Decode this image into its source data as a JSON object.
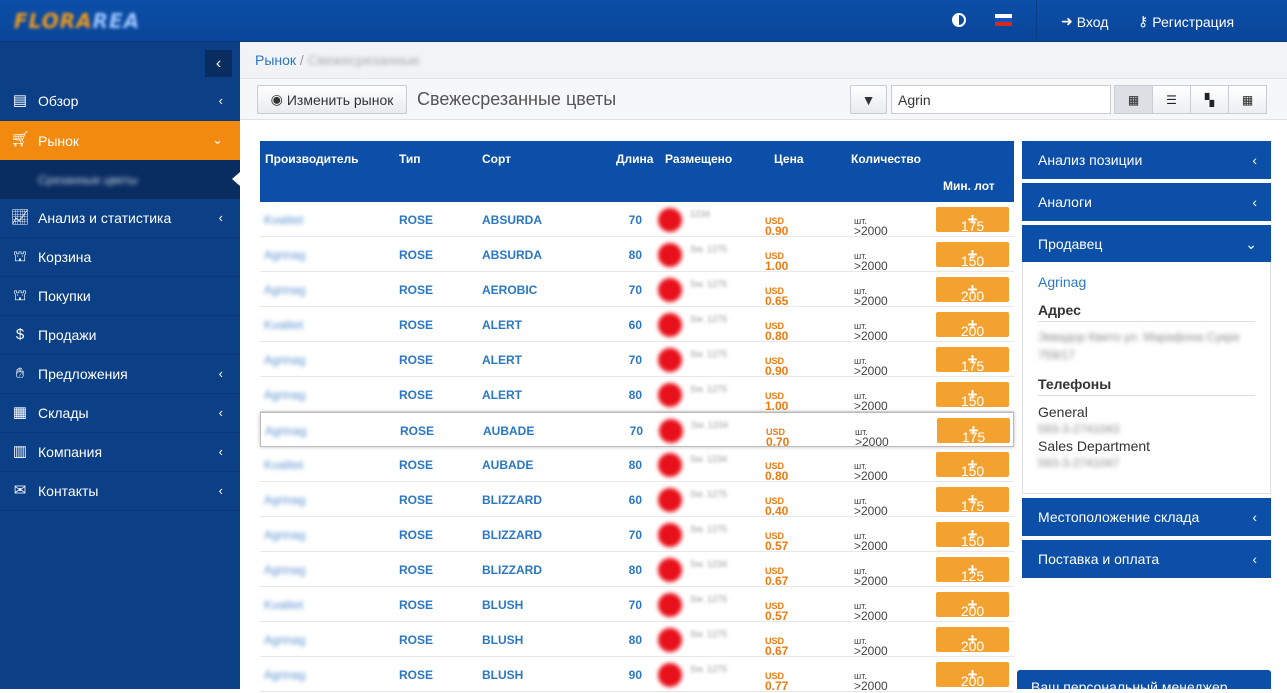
{
  "logo": {
    "text_a": "FLORA",
    "text_b": "REA"
  },
  "header": {
    "login": "Вход",
    "register": "Регистрация",
    "colors": {
      "bar": "#0b4fa8",
      "accent": "#f28a10"
    }
  },
  "sidebar": {
    "items": [
      {
        "label": "Обзор",
        "icon": "dashboard-icon",
        "chev": "‹"
      },
      {
        "label": "Рынок",
        "icon": "cart-icon",
        "chev": "⌄"
      },
      {
        "label": "Анализ и статистика",
        "icon": "chart-icon",
        "chev": "‹"
      },
      {
        "label": "Корзина",
        "icon": "basket-icon",
        "chev": ""
      },
      {
        "label": "Покупки",
        "icon": "purchases-icon",
        "chev": ""
      },
      {
        "label": "Продажи",
        "icon": "sales-icon",
        "chev": ""
      },
      {
        "label": "Предложения",
        "icon": "offers-icon",
        "chev": "‹"
      },
      {
        "label": "Склады",
        "icon": "warehouse-icon",
        "chev": "‹"
      },
      {
        "label": "Компания",
        "icon": "building-icon",
        "chev": "‹"
      },
      {
        "label": "Контакты",
        "icon": "envelope-icon",
        "chev": "‹"
      }
    ],
    "sub": "Срезанные цветы"
  },
  "breadcrumb": {
    "root": "Рынок",
    "current": "Свежесрезанные"
  },
  "toolbar": {
    "change_market": "Изменить рынок",
    "title": "Свежесрезанные цветы",
    "search_value": "Agrin"
  },
  "table": {
    "headers": {
      "producer": "Производитель",
      "type": "Тип",
      "sort": "Сорт",
      "length": "Длина",
      "placed": "Размещено",
      "price": "Цена",
      "qty": "Количество",
      "min_lot": "Мин. лот"
    },
    "rows": [
      {
        "prod": "Kvalitet",
        "type": "ROSE",
        "sort": "ABSURDA",
        "len": "70",
        "place": "1234",
        "price": "0.90",
        "qty": ">2000",
        "lot": "175"
      },
      {
        "prod": "Agrinag",
        "type": "ROSE",
        "sort": "ABSURDA",
        "len": "80",
        "place": "Sw. 1275",
        "price": "1.00",
        "qty": ">2000",
        "lot": "150"
      },
      {
        "prod": "Agrinag",
        "type": "ROSE",
        "sort": "AEROBIC",
        "len": "70",
        "place": "Sw. 1275",
        "price": "0.65",
        "qty": ">2000",
        "lot": "200"
      },
      {
        "prod": "Kvalitet",
        "type": "ROSE",
        "sort": "ALERT",
        "len": "60",
        "place": "Sw. 1275",
        "price": "0.80",
        "qty": ">2000",
        "lot": "200"
      },
      {
        "prod": "Agrinag",
        "type": "ROSE",
        "sort": "ALERT",
        "len": "70",
        "place": "Sw. 1275",
        "price": "0.90",
        "qty": ">2000",
        "lot": "175"
      },
      {
        "prod": "Agrinag",
        "type": "ROSE",
        "sort": "ALERT",
        "len": "80",
        "place": "Sw. 1275",
        "price": "1.00",
        "qty": ">2000",
        "lot": "150"
      },
      {
        "prod": "Agrinag",
        "type": "ROSE",
        "sort": "AUBADE",
        "len": "70",
        "place": "Sw. 1234",
        "price": "0.70",
        "qty": ">2000",
        "lot": "175"
      },
      {
        "prod": "Kvalitet",
        "type": "ROSE",
        "sort": "AUBADE",
        "len": "80",
        "place": "Sw. 1234",
        "price": "0.80",
        "qty": ">2000",
        "lot": "150"
      },
      {
        "prod": "Agrinag",
        "type": "ROSE",
        "sort": "BLIZZARD",
        "len": "60",
        "place": "Sw. 1275",
        "price": "0.40",
        "qty": ">2000",
        "lot": "175"
      },
      {
        "prod": "Agrinag",
        "type": "ROSE",
        "sort": "BLIZZARD",
        "len": "70",
        "place": "Sw. 1275",
        "price": "0.57",
        "qty": ">2000",
        "lot": "150"
      },
      {
        "prod": "Agrinag",
        "type": "ROSE",
        "sort": "BLIZZARD",
        "len": "80",
        "place": "Sw. 1234",
        "price": "0.67",
        "qty": ">2000",
        "lot": "125"
      },
      {
        "prod": "Kvalitet",
        "type": "ROSE",
        "sort": "BLUSH",
        "len": "70",
        "place": "Sw. 1275",
        "price": "0.57",
        "qty": ">2000",
        "lot": "200"
      },
      {
        "prod": "Agrinag",
        "type": "ROSE",
        "sort": "BLUSH",
        "len": "80",
        "place": "Sw. 1275",
        "price": "0.67",
        "qty": ">2000",
        "lot": "200"
      },
      {
        "prod": "Agrinag",
        "type": "ROSE",
        "sort": "BLUSH",
        "len": "90",
        "place": "Sw. 1275",
        "price": "0.77",
        "qty": ">2000",
        "lot": "200"
      }
    ],
    "currency": "USD",
    "unit": "шт."
  },
  "panels": {
    "analysis": "Анализ позиции",
    "analogs": "Аналоги",
    "seller": "Продавец",
    "location": "Местоположение склада",
    "delivery": "Поставка и оплата",
    "manager": "Ваш персональный менеджер"
  },
  "seller": {
    "name": "Agrinag",
    "address_h": "Адрес",
    "address": "Эквадор Квито ул. Марафона Сукре 759/17",
    "phones_h": "Телефоны",
    "phone1_label": "General",
    "phone1": "593-3-2741043",
    "phone2_label": "Sales Department",
    "phone2": "593-3-2741047"
  }
}
